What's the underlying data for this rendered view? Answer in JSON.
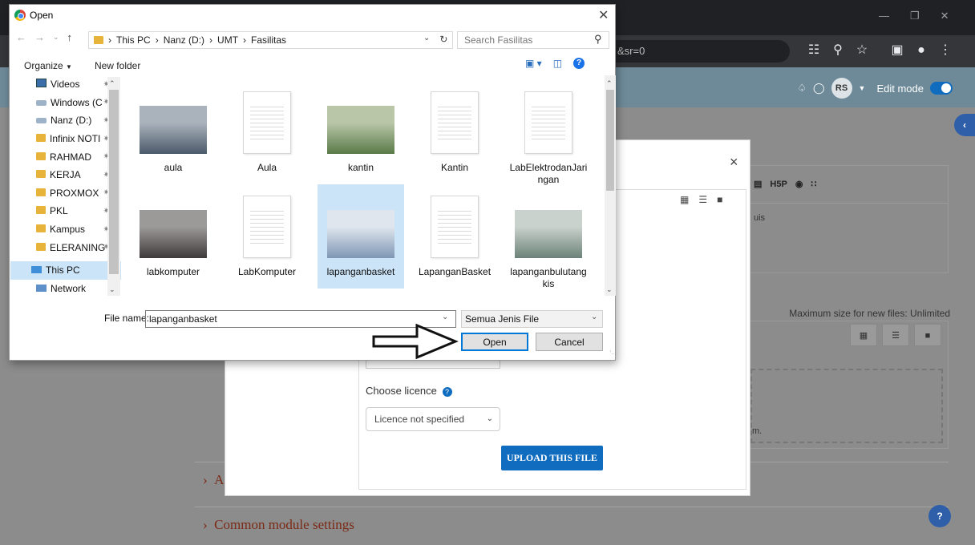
{
  "browser": {
    "url_fragment": "&sr=0",
    "window_controls": [
      "minimize",
      "restore",
      "close"
    ]
  },
  "moodle": {
    "avatar_initials": "RS",
    "edit_mode_label": "Edit mode",
    "sections": [
      {
        "label": "A"
      },
      {
        "label": "Common module settings"
      }
    ],
    "editor_fragment": "uis",
    "max_size_label": "Maximum size for new files: Unlimited",
    "dropzone_fragment": "m.",
    "help_label": "?"
  },
  "modal": {
    "close_label": "×",
    "licence_label": "Choose licence",
    "licence_value": "Licence not specified",
    "upload_label": "UPLOAD THIS FILE"
  },
  "dialog": {
    "title": "Open",
    "breadcrumb": [
      "This PC",
      "Nanz (D:)",
      "UMT",
      "Fasilitas"
    ],
    "search_placeholder": "Search Fasilitas",
    "organize_label": "Organize",
    "new_folder_label": "New folder",
    "nav_items": [
      {
        "label": "Videos",
        "icon": "video-folder-icon"
      },
      {
        "label": "Windows (C",
        "icon": "drive-icon"
      },
      {
        "label": "Nanz (D:)",
        "icon": "drive-icon"
      },
      {
        "label": "Infinix NOTI",
        "icon": "folder-icon"
      },
      {
        "label": "RAHMAD",
        "icon": "folder-icon"
      },
      {
        "label": "KERJA",
        "icon": "folder-icon"
      },
      {
        "label": "PROXMOX",
        "icon": "folder-icon"
      },
      {
        "label": "PKL",
        "icon": "folder-icon"
      },
      {
        "label": "Kampus",
        "icon": "folder-icon"
      },
      {
        "label": "ELERANING",
        "icon": "folder-icon"
      },
      {
        "label": "This PC",
        "icon": "pc-icon"
      },
      {
        "label": "Network",
        "icon": "network-icon"
      }
    ],
    "files": [
      {
        "name": "aula",
        "kind": "photo",
        "colors": [
          "#4b5a6a",
          "#aab3bc"
        ]
      },
      {
        "name": "Aula",
        "kind": "doc"
      },
      {
        "name": "kantin",
        "kind": "photo",
        "colors": [
          "#5a7a48",
          "#b9c7a8"
        ]
      },
      {
        "name": "Kantin",
        "kind": "doc"
      },
      {
        "name": "LabElektrodanJaringan",
        "kind": "doc"
      },
      {
        "name": "labkomputer",
        "kind": "photo",
        "colors": [
          "#3e3a3c",
          "#9c9a98"
        ]
      },
      {
        "name": "LabKomputer",
        "kind": "doc"
      },
      {
        "name": "lapanganbasket",
        "kind": "photo",
        "colors": [
          "#7f97b4",
          "#dfe6ee"
        ],
        "selected": true
      },
      {
        "name": "LapanganBasket",
        "kind": "doc"
      },
      {
        "name": "lapanganbulutangkis",
        "kind": "photo",
        "colors": [
          "#6c8278",
          "#c9d2cc"
        ]
      }
    ],
    "file_name_label": "File name:",
    "file_name_value": "lapanganbasket",
    "file_type_value": "Semua Jenis File",
    "open_label": "Open",
    "cancel_label": "Cancel"
  }
}
